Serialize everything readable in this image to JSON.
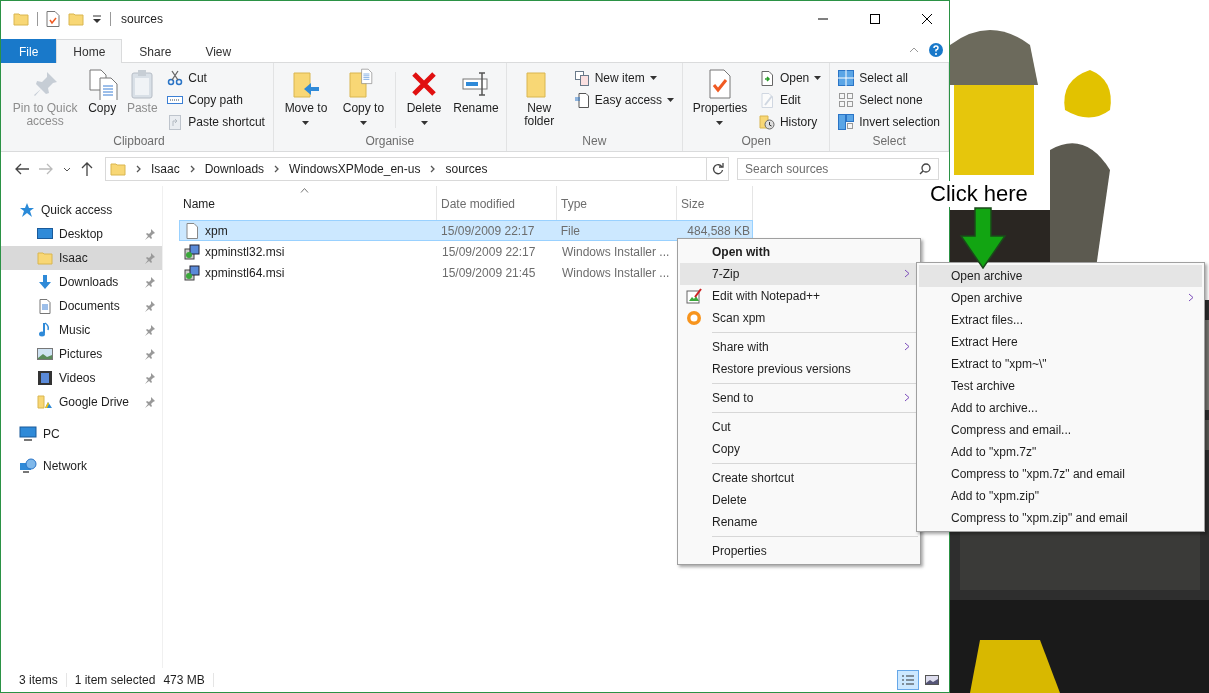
{
  "window": {
    "title": "sources"
  },
  "ribbon": {
    "tabs": [
      {
        "label": "File",
        "kind": "file",
        "selected": false
      },
      {
        "label": "Home",
        "kind": "tab",
        "selected": true
      },
      {
        "label": "Share",
        "kind": "tab",
        "selected": false
      },
      {
        "label": "View",
        "kind": "tab",
        "selected": false
      }
    ],
    "groups": [
      {
        "label": "Clipboard",
        "columns": [
          {
            "kind": "large",
            "label": "Pin to Quick access",
            "disabled": true,
            "dropdown": false
          },
          {
            "kind": "large",
            "label": "Copy",
            "disabled": false,
            "dropdown": false
          },
          {
            "kind": "large",
            "label": "Paste",
            "disabled": true,
            "dropdown": false
          },
          {
            "kind": "stack",
            "items": [
              {
                "label": "Cut",
                "disabled": false,
                "dropdown": false
              },
              {
                "label": "Copy path",
                "disabled": false,
                "dropdown": false
              },
              {
                "label": "Paste shortcut",
                "disabled": true,
                "dropdown": false
              }
            ]
          }
        ]
      },
      {
        "label": "Organise",
        "columns": [
          {
            "kind": "large",
            "label": "Move to",
            "disabled": false,
            "dropdown": true
          },
          {
            "kind": "large",
            "label": "Copy to",
            "disabled": false,
            "dropdown": true
          },
          {
            "kind": "divider"
          },
          {
            "kind": "large",
            "label": "Delete",
            "disabled": false,
            "dropdown": true
          },
          {
            "kind": "large",
            "label": "Rename",
            "disabled": false,
            "dropdown": false
          }
        ]
      },
      {
        "label": "New",
        "columns": [
          {
            "kind": "large",
            "label": "New folder",
            "disabled": false,
            "dropdown": false
          },
          {
            "kind": "stack",
            "items": [
              {
                "label": "New item",
                "disabled": false,
                "dropdown": true
              },
              {
                "label": "Easy access",
                "disabled": false,
                "dropdown": true
              }
            ]
          }
        ]
      },
      {
        "label": "Open",
        "columns": [
          {
            "kind": "large",
            "label": "Properties",
            "disabled": false,
            "dropdown": true
          },
          {
            "kind": "stack",
            "items": [
              {
                "label": "Open",
                "disabled": false,
                "dropdown": true
              },
              {
                "label": "Edit",
                "disabled": true,
                "dropdown": false
              },
              {
                "label": "History",
                "disabled": false,
                "dropdown": false
              }
            ]
          }
        ]
      },
      {
        "label": "Select",
        "columns": [
          {
            "kind": "stack",
            "items": [
              {
                "label": "Select all",
                "disabled": false,
                "dropdown": false
              },
              {
                "label": "Select none",
                "disabled": false,
                "dropdown": false
              },
              {
                "label": "Invert selection",
                "disabled": false,
                "dropdown": false
              }
            ]
          }
        ]
      }
    ]
  },
  "address": {
    "crumbs": [
      "Isaac",
      "Downloads",
      "WindowsXPMode_en-us",
      "sources"
    ]
  },
  "search": {
    "placeholder": "Search sources"
  },
  "sidebar": {
    "items": [
      {
        "label": "Quick access",
        "selected": false,
        "children": [
          {
            "label": "Desktop",
            "pinned": true,
            "selected": false
          },
          {
            "label": "Isaac",
            "pinned": true,
            "selected": true
          },
          {
            "label": "Downloads",
            "pinned": true,
            "selected": false
          },
          {
            "label": "Documents",
            "pinned": true,
            "selected": false
          },
          {
            "label": "Music",
            "pinned": true,
            "selected": false
          },
          {
            "label": "Pictures",
            "pinned": true,
            "selected": false
          },
          {
            "label": "Videos",
            "pinned": true,
            "selected": false
          },
          {
            "label": "Google Drive",
            "pinned": true,
            "selected": false
          }
        ]
      },
      {
        "label": "PC",
        "selected": false
      },
      {
        "label": "Network",
        "selected": false
      }
    ]
  },
  "table": {
    "columns": [
      {
        "label": "Name",
        "sorted": true
      },
      {
        "label": "Date modified",
        "sorted": false
      },
      {
        "label": "Type",
        "sorted": false
      },
      {
        "label": "Size",
        "sorted": false
      }
    ],
    "rows": [
      {
        "kind": "file",
        "name": "xpm",
        "date": "15/09/2009 22:17",
        "type": "File",
        "size": "484,588 KB",
        "selected": true
      },
      {
        "kind": "installer",
        "name": "xpminstl32.msi",
        "date": "15/09/2009 22:17",
        "type": "Windows Installer ...",
        "selected": false
      },
      {
        "kind": "installer",
        "name": "xpminstl64.msi",
        "date": "15/09/2009 21:45",
        "type": "Windows Installer ...",
        "selected": false
      }
    ]
  },
  "status_bar": {
    "count": "3 items",
    "selection": "1 item selected",
    "size": "473 MB",
    "views": [
      {
        "selected": true
      },
      {
        "selected": false
      }
    ]
  },
  "context_menu": {
    "items": [
      {
        "kind": "default",
        "label": "Open with",
        "highlighted": false,
        "submenu": false
      },
      {
        "kind": "item",
        "label": "7-Zip",
        "highlighted": true,
        "submenu": true
      },
      {
        "kind": "icon",
        "label": "Edit with Notepad++",
        "highlighted": false,
        "submenu": false
      },
      {
        "kind": "icon",
        "label": "Scan xpm",
        "highlighted": false,
        "submenu": false
      },
      {
        "kind": "separator"
      },
      {
        "kind": "item",
        "label": "Share with",
        "highlighted": false,
        "submenu": true
      },
      {
        "kind": "item",
        "label": "Restore previous versions",
        "highlighted": false,
        "submenu": false
      },
      {
        "kind": "separator"
      },
      {
        "kind": "item",
        "label": "Send to",
        "highlighted": false,
        "submenu": true
      },
      {
        "kind": "separator"
      },
      {
        "kind": "item",
        "label": "Cut",
        "highlighted": false,
        "submenu": false
      },
      {
        "kind": "item",
        "label": "Copy",
        "highlighted": false,
        "submenu": false
      },
      {
        "kind": "separator"
      },
      {
        "kind": "item",
        "label": "Create shortcut",
        "highlighted": false,
        "submenu": false
      },
      {
        "kind": "item",
        "label": "Delete",
        "highlighted": false,
        "submenu": false
      },
      {
        "kind": "item",
        "label": "Rename",
        "highlighted": false,
        "submenu": false
      },
      {
        "kind": "separator"
      },
      {
        "kind": "item",
        "label": "Properties",
        "highlighted": false,
        "submenu": false
      }
    ]
  },
  "submenu": {
    "items": [
      {
        "label": "Open archive",
        "highlighted": true,
        "submenu": false
      },
      {
        "label": "Open archive",
        "highlighted": false,
        "submenu": true
      },
      {
        "label": "Extract files...",
        "highlighted": false,
        "submenu": false
      },
      {
        "label": "Extract Here",
        "highlighted": false,
        "submenu": false
      },
      {
        "label": "Extract to \"xpm~\\\"",
        "highlighted": false,
        "submenu": false
      },
      {
        "label": "Test archive",
        "highlighted": false,
        "submenu": false
      },
      {
        "label": "Add to archive...",
        "highlighted": false,
        "submenu": false
      },
      {
        "label": "Compress and email...",
        "highlighted": false,
        "submenu": false
      },
      {
        "label": "Add to \"xpm.7z\"",
        "highlighted": false,
        "submenu": false
      },
      {
        "label": "Compress to \"xpm.7z\" and email",
        "highlighted": false,
        "submenu": false
      },
      {
        "label": "Add to \"xpm.zip\"",
        "highlighted": false,
        "submenu": false
      },
      {
        "label": "Compress to \"xpm.zip\" and email",
        "highlighted": false,
        "submenu": false
      }
    ]
  },
  "annotation": {
    "text": "Click here"
  }
}
